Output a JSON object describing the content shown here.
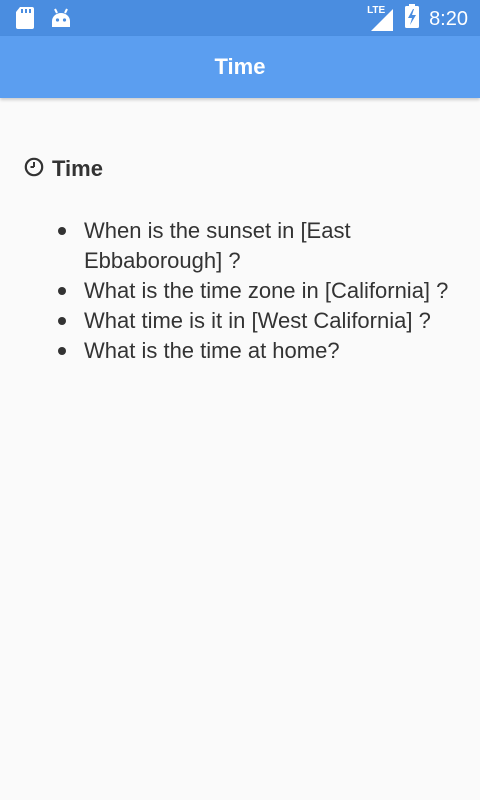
{
  "status_bar": {
    "network": "LTE",
    "time": "8:20",
    "icons": [
      "sd-card-icon",
      "android-icon",
      "lte-signal-icon",
      "battery-charging-icon"
    ]
  },
  "app_bar": {
    "title": "Time"
  },
  "section": {
    "title": "Time",
    "icon": "clock-icon"
  },
  "questions": [
    "When is the sunset in [East Ebbaborough] ?",
    "What is the time zone in [California] ?",
    "What time is it in [West California] ?",
    "What is the time at home?"
  ],
  "colors": {
    "status_bar": "#4a8de0",
    "app_bar": "#5b9ef0",
    "background": "#fafafa",
    "text": "#333333"
  }
}
